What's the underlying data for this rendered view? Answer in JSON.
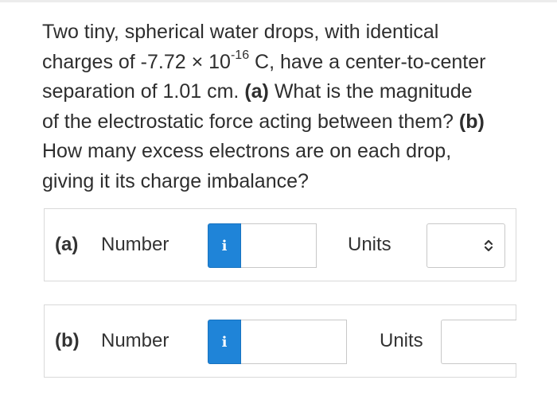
{
  "question": {
    "line1": "Two tiny, spherical water drops, with identical",
    "line2_pre": "charges of -7.72 × 10",
    "line2_exp": "-16",
    "line2_post": " C, have a center-to-center",
    "line3_pre": "separation of 1.01 cm. ",
    "line3_bold": "(a)",
    "line3_post": " What is the magnitude",
    "line4_pre": "of the electrostatic force acting between them? ",
    "line4_bold": "(b)",
    "line5": "How many excess electrons are on each drop,",
    "line6": "giving it its charge imbalance?"
  },
  "parts": {
    "a": {
      "part_label": "(a)",
      "number_label": "Number",
      "info_icon": "i",
      "number_value": "",
      "units_label": "Units",
      "units_selected": "",
      "units_icon": "updown-chevron-icon"
    },
    "b": {
      "part_label": "(b)",
      "number_label": "Number",
      "info_icon": "i",
      "number_value": "",
      "units_label": "Units",
      "units_selected": ""
    }
  },
  "colors": {
    "info_button": "#1f84d8",
    "text": "#333333",
    "border": "#d9d9d9"
  }
}
